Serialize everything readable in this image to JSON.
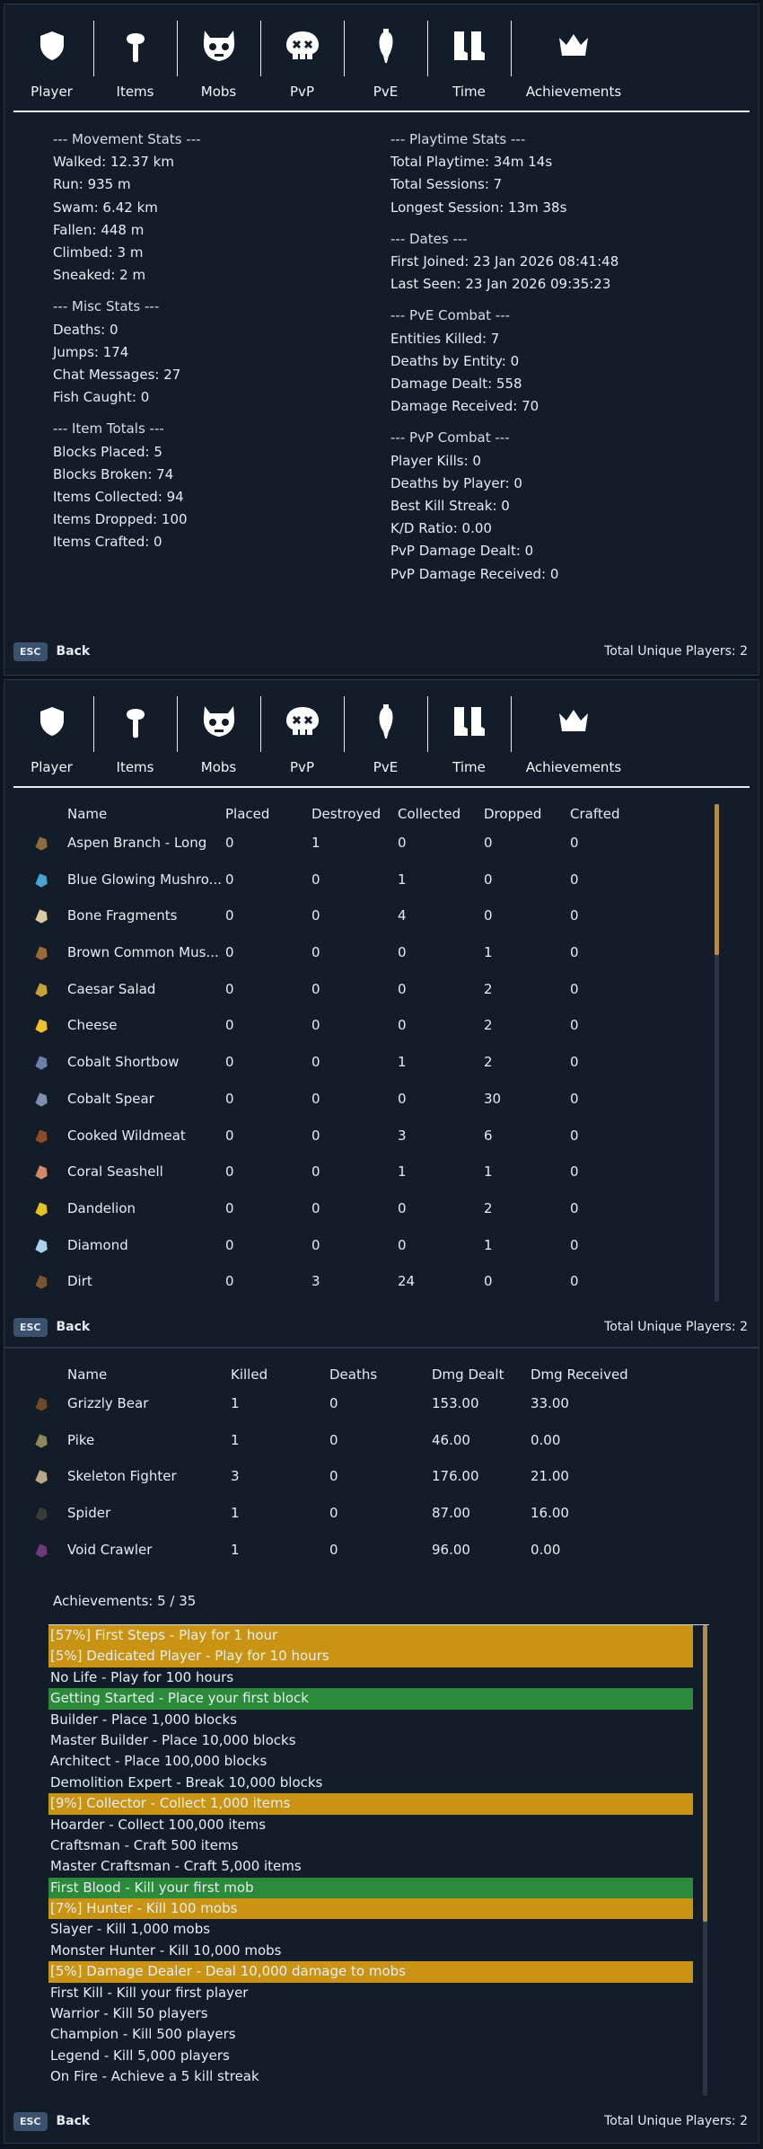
{
  "tabs": [
    "Player",
    "Items",
    "Mobs",
    "PvP",
    "PvE",
    "Time",
    "Achievements"
  ],
  "footer": {
    "esc": "ESC",
    "back": "Back",
    "total": "Total Unique Players: 2"
  },
  "player": {
    "left": [
      {
        "t": "--- Movement Stats ---",
        "h": true
      },
      {
        "t": "Walked: 12.37 km"
      },
      {
        "t": "Run: 935 m"
      },
      {
        "t": "Swam: 6.42 km"
      },
      {
        "t": "Fallen: 448 m"
      },
      {
        "t": "Climbed: 3 m"
      },
      {
        "t": "Sneaked: 2 m"
      },
      {
        "t": "--- Misc Stats ---",
        "h": true
      },
      {
        "t": "Deaths: 0"
      },
      {
        "t": "Jumps: 174"
      },
      {
        "t": "Chat Messages: 27"
      },
      {
        "t": "Fish Caught: 0"
      },
      {
        "t": "--- Item Totals ---",
        "h": true
      },
      {
        "t": "Blocks Placed: 5"
      },
      {
        "t": "Blocks Broken: 74"
      },
      {
        "t": "Items Collected: 94"
      },
      {
        "t": "Items Dropped: 100"
      },
      {
        "t": "Items Crafted: 0"
      }
    ],
    "right": [
      {
        "t": "--- Playtime Stats ---",
        "h": true
      },
      {
        "t": "Total Playtime: 34m 14s"
      },
      {
        "t": "Total Sessions: 7"
      },
      {
        "t": "Longest Session: 13m 38s"
      },
      {
        "t": "--- Dates ---",
        "h": true
      },
      {
        "t": "First Joined: 23 Jan 2026 08:41:48"
      },
      {
        "t": "Last Seen: 23 Jan 2026 09:35:23"
      },
      {
        "t": "--- PvE Combat ---",
        "h": true
      },
      {
        "t": "Entities Killed: 7"
      },
      {
        "t": "Deaths by Entity: 0"
      },
      {
        "t": "Damage Dealt: 558"
      },
      {
        "t": "Damage Received: 70"
      },
      {
        "t": "--- PvP Combat ---",
        "h": true
      },
      {
        "t": "Player Kills: 0"
      },
      {
        "t": "Deaths by Player: 0"
      },
      {
        "t": "Best Kill Streak: 0"
      },
      {
        "t": "K/D Ratio: 0.00"
      },
      {
        "t": "PvP Damage Dealt: 0"
      },
      {
        "t": "PvP Damage Received: 0"
      }
    ]
  },
  "items": {
    "headers": [
      "Name",
      "Placed",
      "Destroyed",
      "Collected",
      "Dropped",
      "Crafted"
    ],
    "rows": [
      {
        "icon": "aspen-branch-icon",
        "color": "#8a6d3f",
        "name": "Aspen Branch - Long",
        "v": [
          "0",
          "1",
          "0",
          "0",
          "0"
        ]
      },
      {
        "icon": "blue-mushroom-icon",
        "color": "#4aa3d6",
        "name": "Blue Glowing Mushro...",
        "v": [
          "0",
          "0",
          "1",
          "0",
          "0"
        ]
      },
      {
        "icon": "bone-fragments-icon",
        "color": "#d9c9a1",
        "name": "Bone Fragments",
        "v": [
          "0",
          "0",
          "4",
          "0",
          "0"
        ]
      },
      {
        "icon": "brown-mushroom-icon",
        "color": "#9a6a3a",
        "name": "Brown Common Mus...",
        "v": [
          "0",
          "0",
          "0",
          "1",
          "0"
        ]
      },
      {
        "icon": "caesar-salad-icon",
        "color": "#c8a13a",
        "name": "Caesar Salad",
        "v": [
          "0",
          "0",
          "0",
          "2",
          "0"
        ]
      },
      {
        "icon": "cheese-icon",
        "color": "#f2c12e",
        "name": "Cheese",
        "v": [
          "0",
          "0",
          "0",
          "2",
          "0"
        ]
      },
      {
        "icon": "cobalt-shortbow-icon",
        "color": "#6c7fa8",
        "name": "Cobalt Shortbow",
        "v": [
          "0",
          "0",
          "1",
          "2",
          "0"
        ]
      },
      {
        "icon": "cobalt-spear-icon",
        "color": "#7f8fb0",
        "name": "Cobalt Spear",
        "v": [
          "0",
          "0",
          "0",
          "30",
          "0"
        ]
      },
      {
        "icon": "cooked-wildmeat-icon",
        "color": "#8b4a2a",
        "name": "Cooked Wildmeat",
        "v": [
          "0",
          "0",
          "3",
          "6",
          "0"
        ]
      },
      {
        "icon": "coral-seashell-icon",
        "color": "#d48a6a",
        "name": "Coral Seashell",
        "v": [
          "0",
          "0",
          "1",
          "1",
          "0"
        ]
      },
      {
        "icon": "dandelion-icon",
        "color": "#e3c22a",
        "name": "Dandelion",
        "v": [
          "0",
          "0",
          "0",
          "2",
          "0"
        ]
      },
      {
        "icon": "diamond-icon",
        "color": "#a9d4ec",
        "name": "Diamond",
        "v": [
          "0",
          "0",
          "0",
          "1",
          "0"
        ]
      },
      {
        "icon": "dirt-icon",
        "color": "#7a5332",
        "name": "Dirt",
        "v": [
          "0",
          "3",
          "24",
          "0",
          "0"
        ]
      }
    ]
  },
  "mobs": {
    "headers": [
      "Name",
      "Killed",
      "Deaths",
      "Dmg Dealt",
      "Dmg Received"
    ],
    "rows": [
      {
        "icon": "grizzly-bear-icon",
        "color": "#6b4a2a",
        "name": "Grizzly Bear",
        "v": [
          "1",
          "0",
          "153.00",
          "33.00"
        ]
      },
      {
        "icon": "pike-icon",
        "color": "#8a8a5a",
        "name": "Pike",
        "v": [
          "1",
          "0",
          "46.00",
          "0.00"
        ]
      },
      {
        "icon": "skeleton-fighter-icon",
        "color": "#b8a78a",
        "name": "Skeleton Fighter",
        "v": [
          "3",
          "0",
          "176.00",
          "21.00"
        ]
      },
      {
        "icon": "spider-icon",
        "color": "#3a3a3a",
        "name": "Spider",
        "v": [
          "1",
          "0",
          "87.00",
          "16.00"
        ]
      },
      {
        "icon": "void-crawler-icon",
        "color": "#6a3a7a",
        "name": "Void Crawler",
        "v": [
          "1",
          "0",
          "96.00",
          "0.00"
        ]
      }
    ]
  },
  "achievements": {
    "count_label": "Achievements: 5 / 35",
    "colors": {
      "progress": "#c99413",
      "done": "#2c8b3a"
    },
    "rows": [
      {
        "t": "[57%] First Steps - Play for 1 hour",
        "s": "progress"
      },
      {
        "t": "[5%] Dedicated Player - Play for 10 hours",
        "s": "progress"
      },
      {
        "t": "No Life - Play for 100 hours",
        "s": "none"
      },
      {
        "t": "Getting Started - Place your first block",
        "s": "done"
      },
      {
        "t": "Builder - Place 1,000 blocks",
        "s": "none"
      },
      {
        "t": "Master Builder - Place 10,000 blocks",
        "s": "none"
      },
      {
        "t": "Architect - Place 100,000 blocks",
        "s": "none"
      },
      {
        "t": "Demolition Expert - Break 10,000 blocks",
        "s": "none"
      },
      {
        "t": "[9%] Collector - Collect 1,000 items",
        "s": "progress"
      },
      {
        "t": "Hoarder - Collect 100,000 items",
        "s": "none"
      },
      {
        "t": "Craftsman - Craft 500 items",
        "s": "none"
      },
      {
        "t": "Master Craftsman - Craft 5,000 items",
        "s": "none"
      },
      {
        "t": "First Blood - Kill your first mob",
        "s": "done"
      },
      {
        "t": "[7%] Hunter - Kill 100 mobs",
        "s": "progress"
      },
      {
        "t": "Slayer - Kill 1,000 mobs",
        "s": "none"
      },
      {
        "t": "Monster Hunter - Kill 10,000 mobs",
        "s": "none"
      },
      {
        "t": "[5%] Damage Dealer - Deal 10,000 damage to mobs",
        "s": "progress"
      },
      {
        "t": "First Kill - Kill your first player",
        "s": "none"
      },
      {
        "t": "Warrior - Kill 50 players",
        "s": "none"
      },
      {
        "t": "Champion - Kill 500 players",
        "s": "none"
      },
      {
        "t": "Legend - Kill 5,000 players",
        "s": "none"
      },
      {
        "t": "On Fire - Achieve a 5 kill streak",
        "s": "none"
      }
    ]
  }
}
